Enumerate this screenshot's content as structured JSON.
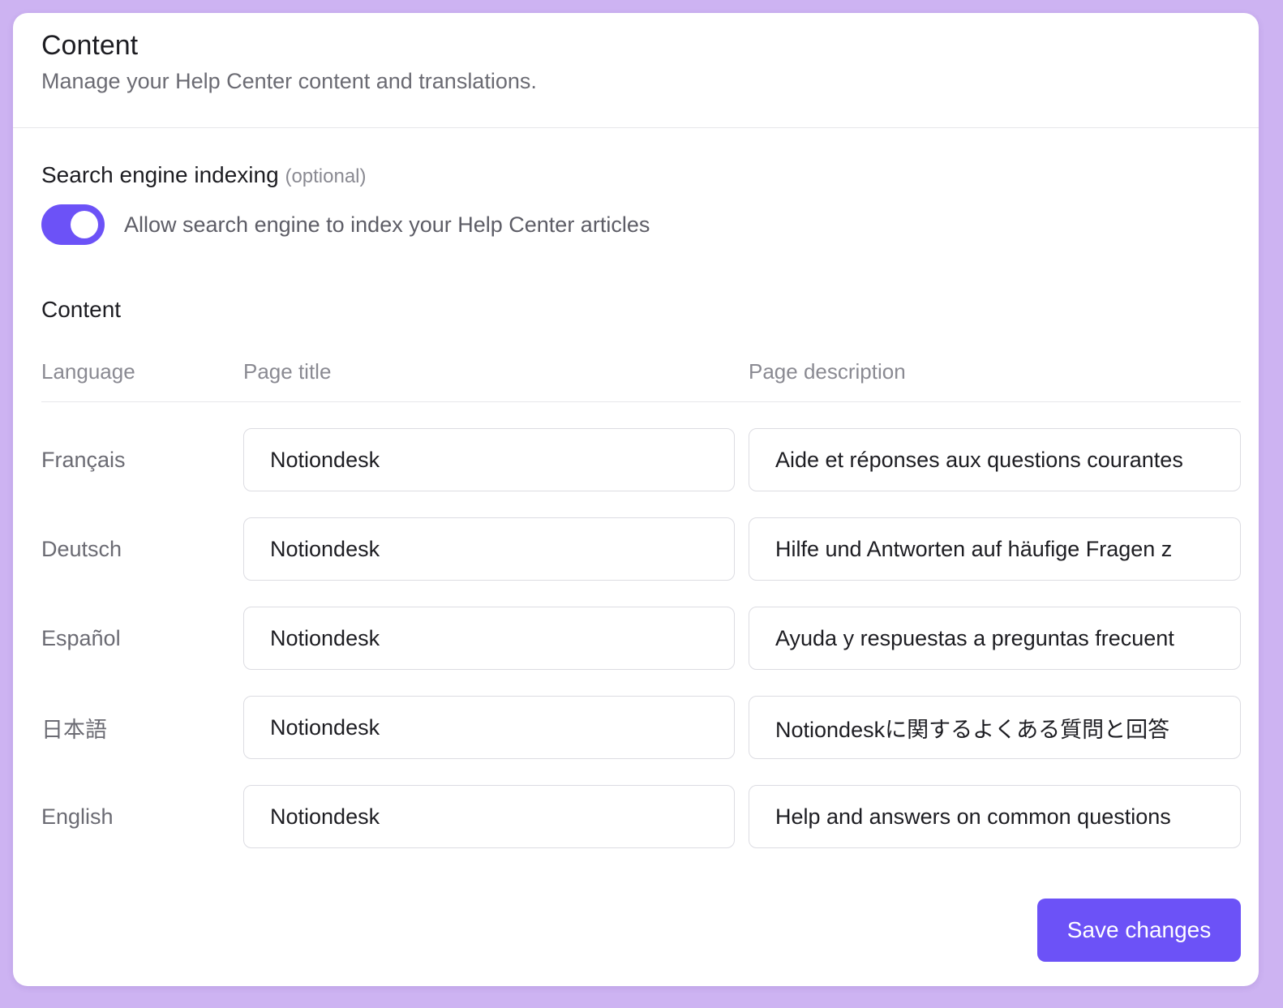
{
  "header": {
    "title": "Content",
    "subtitle": "Manage your Help Center content and translations."
  },
  "indexing": {
    "label": "Search engine indexing",
    "optional": "(optional)",
    "toggle_on": true,
    "toggle_text": "Allow search engine to index your Help Center articles"
  },
  "content": {
    "label": "Content",
    "columns": {
      "language": "Language",
      "title": "Page title",
      "description": "Page description"
    },
    "rows": [
      {
        "language": "Français",
        "title": "Notiondesk",
        "description": "Aide et réponses aux questions courantes"
      },
      {
        "language": "Deutsch",
        "title": "Notiondesk",
        "description": "Hilfe und Antworten auf häufige Fragen z"
      },
      {
        "language": "Español",
        "title": "Notiondesk",
        "description": "Ayuda y respuestas a preguntas frecuent"
      },
      {
        "language": "日本語",
        "title": "Notiondesk",
        "description": "Notiondeskに関するよくある質問と回答"
      },
      {
        "language": "English",
        "title": "Notiondesk",
        "description": "Help and answers on common questions"
      }
    ]
  },
  "actions": {
    "save_label": "Save changes"
  },
  "colors": {
    "accent": "#6c52f7",
    "background": "#cdb3f2"
  }
}
